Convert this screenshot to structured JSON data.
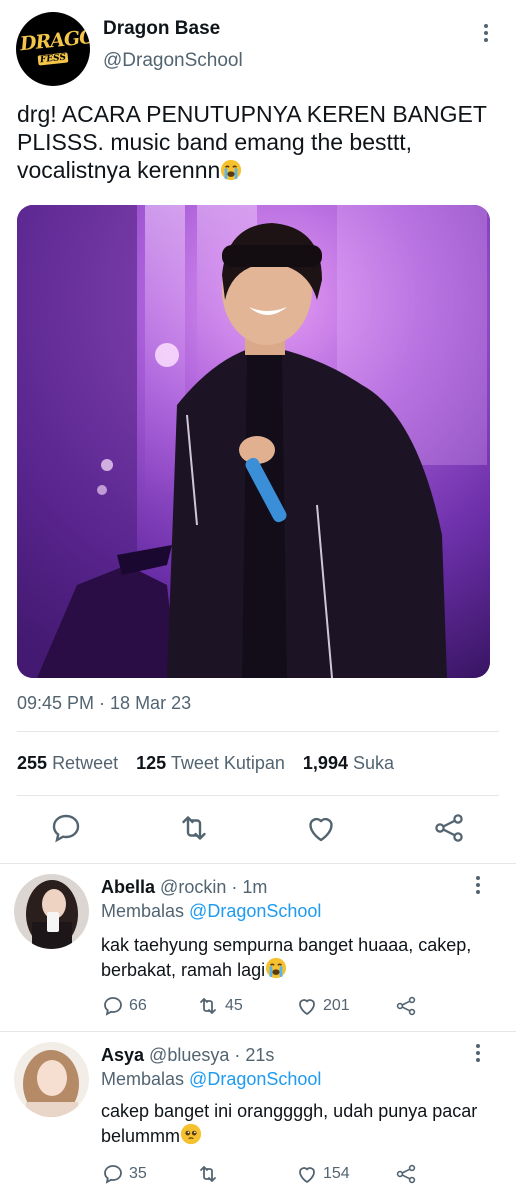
{
  "tweet": {
    "author_name": "Dragon Base",
    "author_handle": "@DragonSchool",
    "avatar_logo_line1": "DRAGON",
    "avatar_logo_line2": "FESS",
    "text": "drg! ACARA PENUTUPNYA KEREN BANGET PLISSS. music band emang the besttt, vocalistnya kerennn",
    "text_emoji": "loudly-crying-face",
    "timestamp": "09:45 PM · 18 Mar 23",
    "stats": {
      "retweets_count": "255",
      "retweets_label": "Retweet",
      "quotes_count": "125",
      "quotes_label": "Tweet Kutipan",
      "likes_count": "1,994",
      "likes_label": "Suka"
    }
  },
  "replies": [
    {
      "name": "Abella",
      "handle": "@rockin",
      "time": "· 1m",
      "replying_prefix": "Membalas",
      "replying_to": "@DragonSchool",
      "text": "kak taehyung sempurna banget huaaa, cakep, berbakat, ramah lagi",
      "text_emoji": "loudly-crying-face",
      "reply_count": "66",
      "retweet_count": "45",
      "like_count": "201"
    },
    {
      "name": "Asya",
      "handle": "@bluesya",
      "time": "· 21s",
      "replying_prefix": "Membalas",
      "replying_to": "@DragonSchool",
      "text": "cakep banget ini oranggggh, udah punya pacar belummm",
      "text_emoji": "pleading-face",
      "reply_count": "35",
      "retweet_count": "",
      "like_count": "154"
    }
  ],
  "colors": {
    "text_primary": "#0f1419",
    "text_secondary": "#536471",
    "link": "#1d9bf0",
    "divider": "#e3e7ea"
  },
  "icons": [
    "more-vertical-icon",
    "reply-icon",
    "retweet-icon",
    "like-icon",
    "share-icon"
  ]
}
